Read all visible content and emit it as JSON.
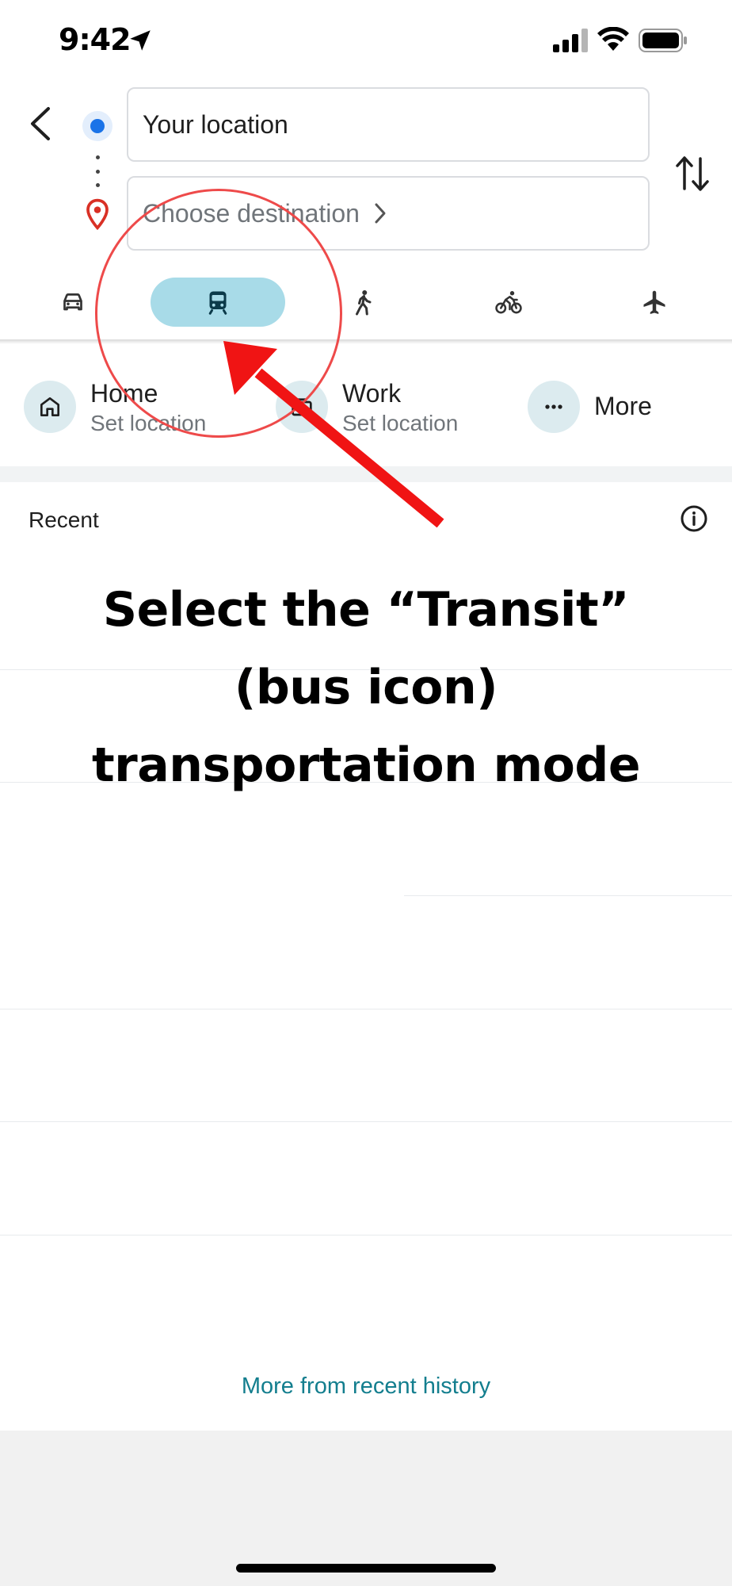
{
  "status_bar": {
    "time": "9:42"
  },
  "search": {
    "origin_value": "Your location",
    "destination_placeholder": "Choose destination"
  },
  "modes": [
    {
      "name": "Driving",
      "icon": "car-icon",
      "selected": false
    },
    {
      "name": "Transit",
      "icon": "train-icon",
      "selected": true
    },
    {
      "name": "Walking",
      "icon": "walk-icon",
      "selected": false
    },
    {
      "name": "Cycling",
      "icon": "bike-icon",
      "selected": false
    },
    {
      "name": "Flights",
      "icon": "plane-icon",
      "selected": false
    }
  ],
  "shortcuts": {
    "home": {
      "title": "Home",
      "subtitle": "Set location"
    },
    "work": {
      "title": "Work",
      "subtitle": "Set location"
    },
    "more": {
      "title": "More"
    }
  },
  "recent": {
    "label": "Recent",
    "more_link": "More from recent history"
  },
  "overlay": {
    "line1": "Select the “Transit”",
    "line2": "(bus icon)",
    "line3": "transportation mode"
  },
  "colors": {
    "accent_blue": "#1a73e8",
    "transit_selected": "#a8dbe8",
    "link_teal": "#137e8e",
    "annotation_red": "#ee4a4a"
  }
}
